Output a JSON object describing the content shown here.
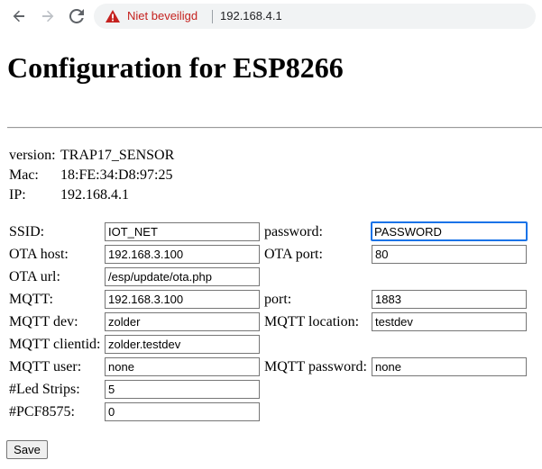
{
  "browser": {
    "security_label": "Niet beveiligd",
    "url": "192.168.4.1",
    "warning_color": "#c5221f"
  },
  "page": {
    "title": "Configuration for ESP8266"
  },
  "info": {
    "version_label": "version:",
    "version_value": "TRAP17_SENSOR",
    "mac_label": "Mac:",
    "mac_value": "18:FE:34:D8:97:25",
    "ip_label": "IP:",
    "ip_value": "192.168.4.1"
  },
  "form": {
    "ssid_label": "SSID:",
    "ssid_value": "IOT_NET",
    "password_label": "password:",
    "password_value": "PASSWORD",
    "ota_host_label": "OTA host:",
    "ota_host_value": "192.168.3.100",
    "ota_port_label": "OTA port:",
    "ota_port_value": "80",
    "ota_url_label": "OTA url:",
    "ota_url_value": "/esp/update/ota.php",
    "mqtt_label": "MQTT:",
    "mqtt_value": "192.168.3.100",
    "port_label": "port:",
    "port_value": "1883",
    "mqtt_dev_label": "MQTT dev:",
    "mqtt_dev_value": "zolder",
    "mqtt_location_label": "MQTT location:",
    "mqtt_location_value": "testdev",
    "mqtt_clientid_label": "MQTT clientid:",
    "mqtt_clientid_value": "zolder.testdev",
    "mqtt_user_label": "MQTT user:",
    "mqtt_user_value": "none",
    "mqtt_password_label": "MQTT password:",
    "mqtt_password_value": "none",
    "led_strips_label": "#Led Strips:",
    "led_strips_value": "5",
    "pcf_label": "#PCF8575:",
    "pcf_value": "0",
    "save_label": "Save"
  }
}
